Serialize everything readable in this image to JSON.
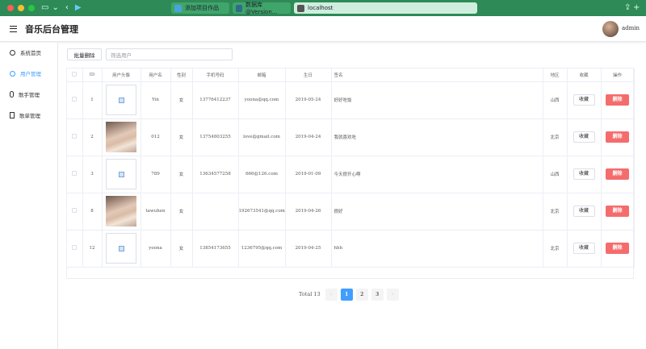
{
  "browser": {
    "tabs": [
      {
        "label": "添加项目作品"
      },
      {
        "label": "数据库 @Version..."
      },
      {
        "label": "localhost"
      }
    ]
  },
  "header": {
    "title": "音乐后台管理",
    "username": "admin"
  },
  "sidebar": {
    "items": [
      {
        "label": "系统首页",
        "icon": "clock-icon"
      },
      {
        "label": "用户管理",
        "icon": "user-icon"
      },
      {
        "label": "歌手管理",
        "icon": "microphone-icon"
      },
      {
        "label": "歌单管理",
        "icon": "document-icon"
      }
    ]
  },
  "toolbar": {
    "bulk_delete": "批量删除",
    "filter_placeholder": "筛选用户"
  },
  "table": {
    "headers": [
      "ID",
      "用户头像",
      "用户名",
      "性别",
      "手机号码",
      "邮箱",
      "生日",
      "签名",
      "地区",
      "收藏",
      "操作"
    ],
    "fav_label": "收藏",
    "delete_label": "删除",
    "rows": [
      {
        "id": "1",
        "avatar": "broken",
        "username": "Yin",
        "gender": "女",
        "phone": "13776412237",
        "email": "yoona@qq.com",
        "birthday": "2019-05-24",
        "signature": "好好吃饭",
        "region": "山西"
      },
      {
        "id": "2",
        "avatar": "photo",
        "username": "012",
        "gender": "女",
        "phone": "13754803255",
        "email": "love@gmail.com",
        "birthday": "2019-04-24",
        "signature": "我就喜欢吃",
        "region": "北京"
      },
      {
        "id": "3",
        "avatar": "broken",
        "username": "789",
        "gender": "女",
        "phone": "13634577258",
        "email": "666@126.com",
        "birthday": "2019-01-09",
        "signature": "今天很开心啊",
        "region": "山西"
      },
      {
        "id": "8",
        "avatar": "photo",
        "username": "tawuhen",
        "gender": "女",
        "phone": "",
        "email": "192673541@qq.com",
        "birthday": "2019-04-26",
        "signature": "很好",
        "region": "北京"
      },
      {
        "id": "12",
        "avatar": "broken",
        "username": "yoona",
        "gender": "女",
        "phone": "13854173655",
        "email": "1236795@qq.com",
        "birthday": "2019-04-25",
        "signature": "hhh",
        "region": "北京"
      }
    ]
  },
  "pagination": {
    "total": "Total 13",
    "pages": [
      "1",
      "2",
      "3"
    ],
    "current": "1",
    "prev": "‹",
    "next": "›"
  }
}
